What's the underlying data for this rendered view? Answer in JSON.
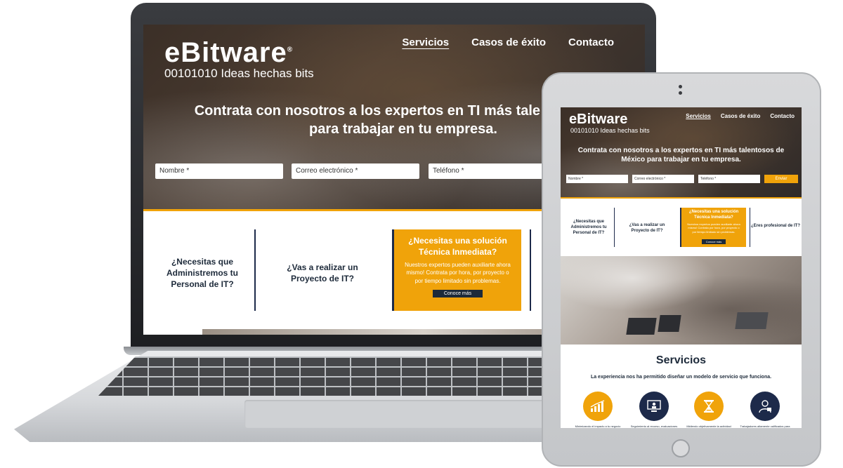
{
  "brand": {
    "name": "Bitware",
    "tagline": "00101010 Ideas hechas bits"
  },
  "nav": [
    "Servicios",
    "Casos de éxito",
    "Contacto"
  ],
  "hero": {
    "laptop_headline": "Contrata con nosotros a los expertos en TI más tale de México para trabajar en tu empresa.",
    "tablet_headline": "Contrata con nosotros a los expertos en TI más talentosos de México para trabajar en tu empresa."
  },
  "form": {
    "name_placeholder": "Nombre *",
    "email_placeholder": "Correo electrónico *",
    "phone_placeholder": "Teléfono *",
    "send_label": "Enviar"
  },
  "cards": {
    "personal": "¿Necesitas que Administremos tu Personal de IT?",
    "proyecto": "¿Vas a realizar un Proyecto de IT?",
    "solucion_title": "¿Necesitas una solución Técnica Inmediata?",
    "solucion_body": "Nuestros expertos pueden auxiliarte ahora mismo! Contrata por hora, por proyecto o por tiempo limitado sin problemas.",
    "solucion_button": "Conoce más",
    "profesional": "¿Eres profesional de IT?"
  },
  "services": {
    "title": "Servicios",
    "subtitle": "La experiencia nos ha permitido diseñar un modelo de servicio que funciona.",
    "items": [
      {
        "icon": "growth-chart-icon",
        "color": "#f0a30a",
        "caption": "Minimizando el impacto a tu negocio"
      },
      {
        "icon": "monitor-person-icon",
        "color": "#1d2a4a",
        "caption": "Seguimiento al recurso, evaluaciones"
      },
      {
        "icon": "hourglass-icon",
        "color": "#f0a30a",
        "caption": "Midiendo objetivamente la actividad"
      },
      {
        "icon": "professional-icon",
        "color": "#1d2a4a",
        "caption": "Trabajadores altamente calificados para"
      }
    ]
  },
  "colors": {
    "accent": "#f0a30a",
    "navy": "#1d2a4a"
  }
}
